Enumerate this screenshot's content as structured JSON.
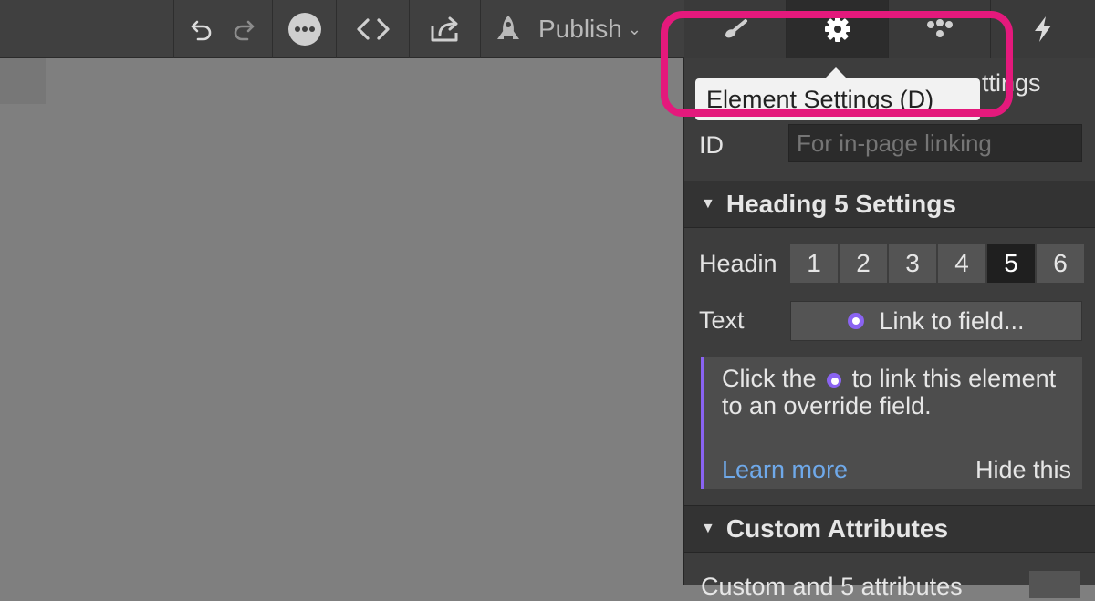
{
  "toolbar": {
    "publish_label": "Publish"
  },
  "tooltip": {
    "text": "Element Settings (D)",
    "tail_text": "ttings"
  },
  "panel": {
    "id_label": "ID",
    "id_placeholder": "For in-page linking",
    "heading_section_title": "Heading 5 Settings",
    "heading_label": "Headin",
    "heading_levels": [
      "1",
      "2",
      "3",
      "4",
      "5",
      "6"
    ],
    "heading_active": "5",
    "text_label": "Text",
    "link_button_label": "Link to field...",
    "hint": {
      "prefix": "Click the",
      "suffix": "to link this element to an override field.",
      "learn_more": "Learn more",
      "hide_this": "Hide this"
    },
    "custom_section_title": "Custom Attributes",
    "custom_partial": "Custom and 5 attributes"
  },
  "colors": {
    "accent_purple": "#8a63f2",
    "link_blue": "#6fa9ea",
    "highlight_pink": "#e4197c"
  }
}
